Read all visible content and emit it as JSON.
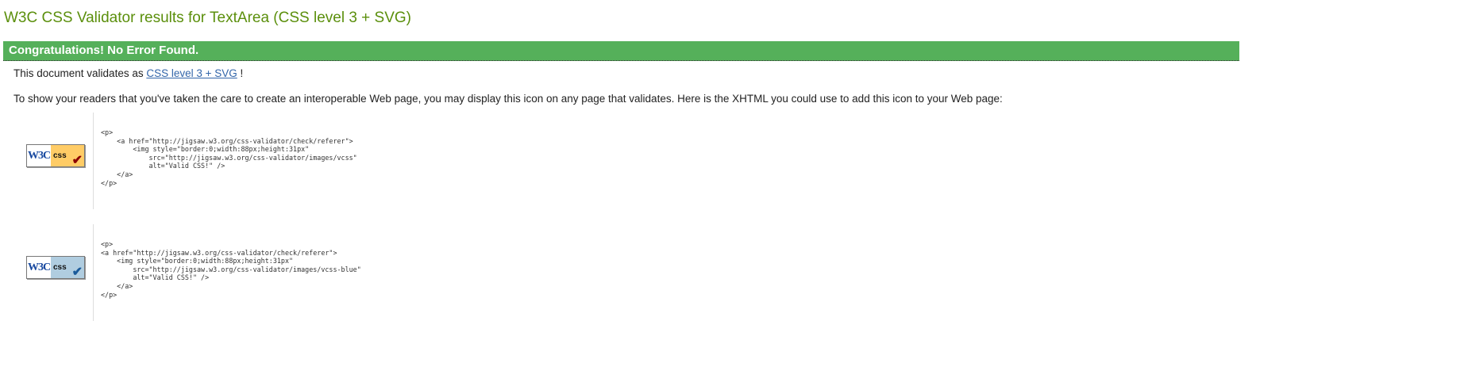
{
  "title": "W3C CSS Validator results for TextArea (CSS level 3 + SVG)",
  "banner": "Congratulations! No Error Found.",
  "validates": {
    "prefix": "This document validates as ",
    "link": "CSS level 3 + SVG",
    "suffix": " !"
  },
  "instructions": "To show your readers that you've taken the care to create an interoperable Web page, you may display this icon on any page that validates. Here is the XHTML you could use to add this icon to your Web page:",
  "badges": [
    {
      "w3c": "W3C",
      "css": "css",
      "check": "✔",
      "bg": "#ffcc66",
      "check_color": "#8b0000",
      "code": "<p>\n    <a href=\"http://jigsaw.w3.org/css-validator/check/referer\">\n        <img style=\"border:0;width:88px;height:31px\"\n            src=\"http://jigsaw.w3.org/css-validator/images/vcss\"\n            alt=\"Valid CSS!\" />\n    </a>\n</p>"
    },
    {
      "w3c": "W3C",
      "css": "css",
      "check": "✔",
      "bg": "#b0cde0",
      "check_color": "#1a5a9a",
      "code": "<p>\n<a href=\"http://jigsaw.w3.org/css-validator/check/referer\">\n    <img style=\"border:0;width:88px;height:31px\"\n        src=\"http://jigsaw.w3.org/css-validator/images/vcss-blue\"\n        alt=\"Valid CSS!\" />\n    </a>\n</p>"
    }
  ]
}
